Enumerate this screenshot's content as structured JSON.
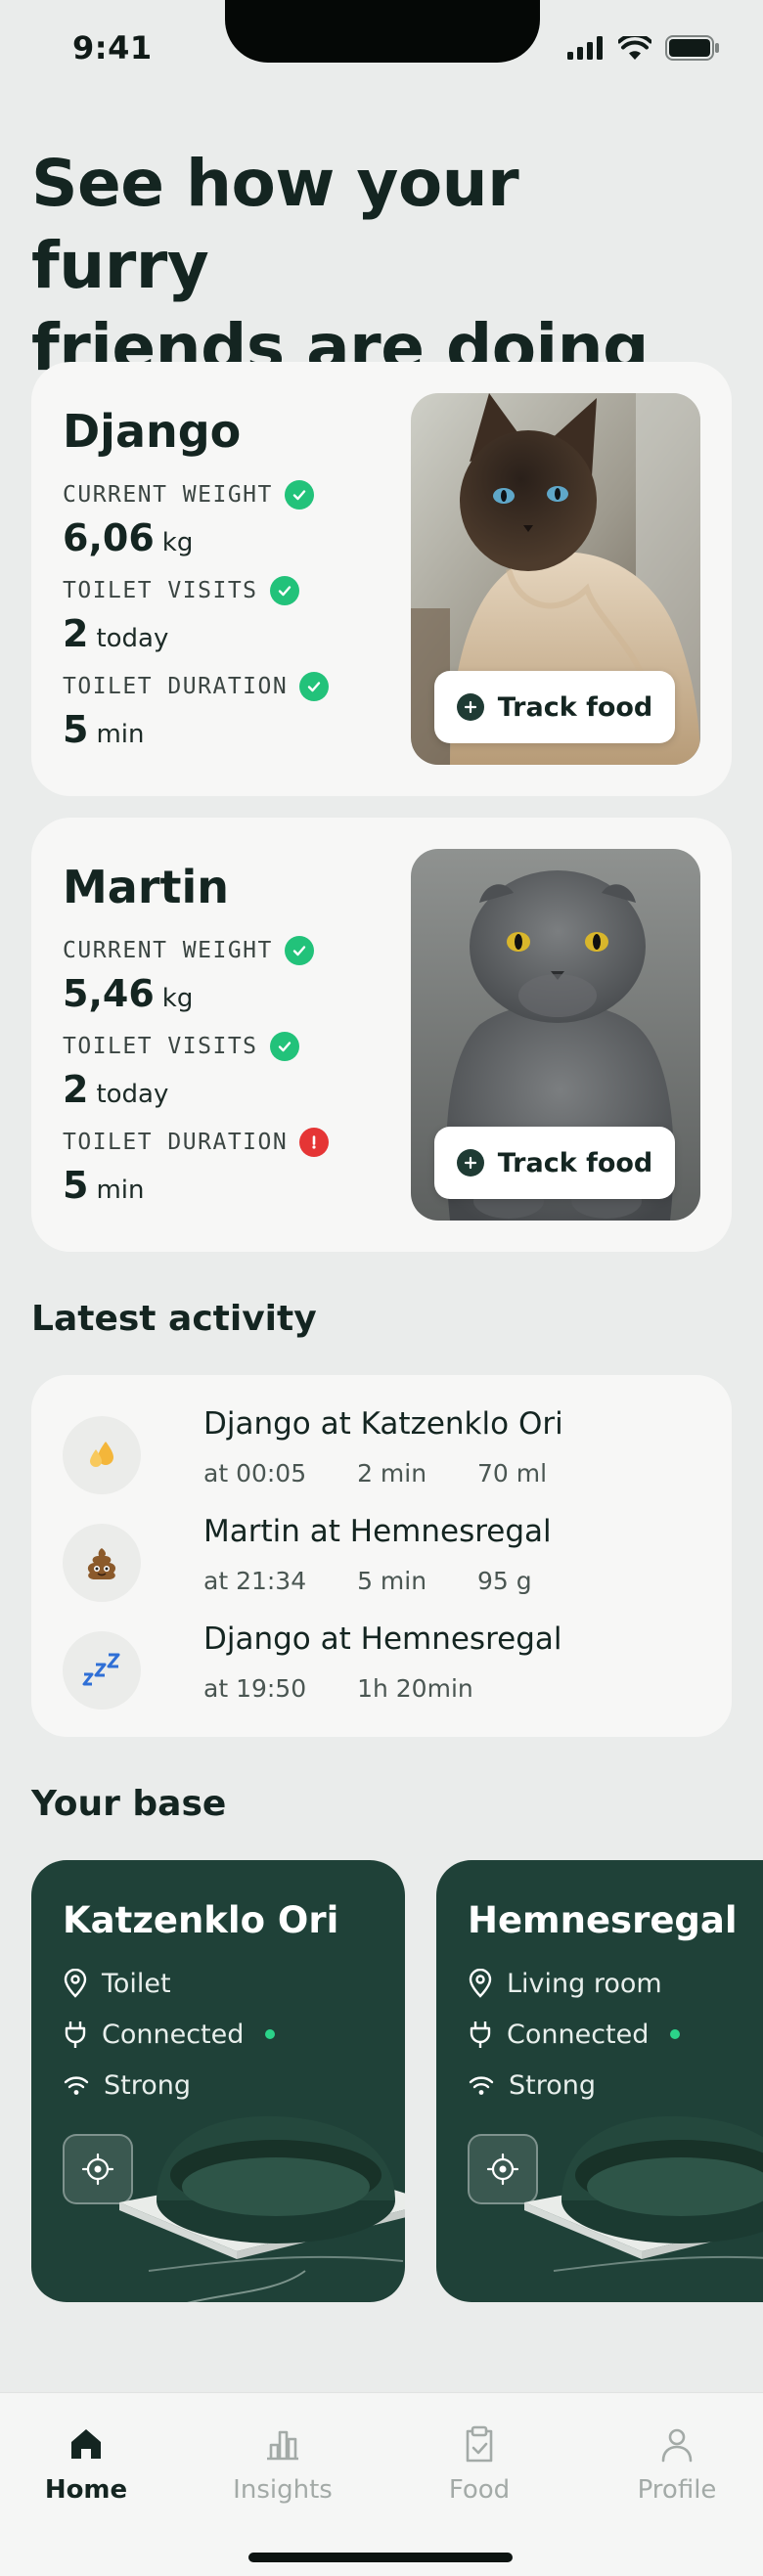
{
  "status_bar": {
    "time": "9:41"
  },
  "headline": "See how your furry\nfriends are doing",
  "pets": [
    {
      "name": "Django",
      "stats": [
        {
          "label": "CURRENT WEIGHT",
          "value": "6,06",
          "unit": "kg",
          "status": "ok"
        },
        {
          "label": "TOILET VISITS",
          "value": "2",
          "unit": "today",
          "status": "ok"
        },
        {
          "label": "TOILET DURATION",
          "value": "5",
          "unit": "min",
          "status": "ok"
        }
      ],
      "track_label": "Track food"
    },
    {
      "name": "Martin",
      "stats": [
        {
          "label": "CURRENT WEIGHT",
          "value": "5,46",
          "unit": "kg",
          "status": "ok"
        },
        {
          "label": "TOILET VISITS",
          "value": "2",
          "unit": "today",
          "status": "ok"
        },
        {
          "label": "TOILET DURATION",
          "value": "5",
          "unit": "min",
          "status": "warning"
        }
      ],
      "track_label": "Track food"
    }
  ],
  "activity": {
    "title": "Latest activity",
    "items": [
      {
        "icon": "droplets-icon",
        "title": "Django at Katzenklo Ori",
        "time": "at 00:05",
        "duration": "2 min",
        "amount": "70 ml"
      },
      {
        "icon": "poop-icon",
        "title": "Martin at Hemnesregal",
        "time": "at 21:34",
        "duration": "5 min",
        "amount": "95 g"
      },
      {
        "icon": "sleep-icon",
        "title": "Django at Hemnesregal",
        "time": "at 19:50",
        "duration": "1h 20min",
        "amount": ""
      }
    ]
  },
  "bases": {
    "title": "Your base",
    "items": [
      {
        "name": "Katzenklo Ori",
        "location": "Toilet",
        "connection": "Connected",
        "signal": "Strong"
      },
      {
        "name": "Hemnesregal",
        "location": "Living room",
        "connection": "Connected",
        "signal": "Strong"
      }
    ]
  },
  "nav": {
    "items": [
      {
        "label": "Home",
        "icon": "home-icon",
        "active": true
      },
      {
        "label": "Insights",
        "icon": "chart-icon",
        "active": false
      },
      {
        "label": "Food",
        "icon": "clipboard-icon",
        "active": false
      },
      {
        "label": "Profile",
        "icon": "person-icon",
        "active": false
      }
    ]
  },
  "colors": {
    "background": "#eaeceb",
    "card": "#f7f7f6",
    "base_card": "#1f4138",
    "ok": "#22c27a",
    "warning": "#e53535",
    "text": "#142521"
  }
}
